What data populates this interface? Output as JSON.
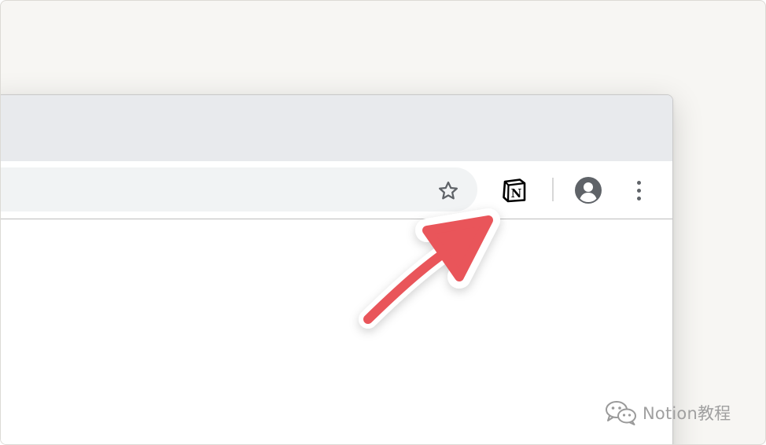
{
  "toolbar": {
    "icons": [
      "star-icon",
      "notion-extension-icon",
      "account-icon",
      "more-vert-icon"
    ],
    "notion_letter": "N"
  },
  "annotation": {
    "arrow_color": "#e9545a",
    "arrow_outline": "#ffffff"
  },
  "watermark": {
    "text": "Notion教程",
    "icon": "wechat-icon"
  },
  "colors": {
    "background": "#f7f6f3",
    "tabstrip": "#e8eaed",
    "omnibox": "#f1f3f4",
    "icon_gray": "#5f6368"
  }
}
